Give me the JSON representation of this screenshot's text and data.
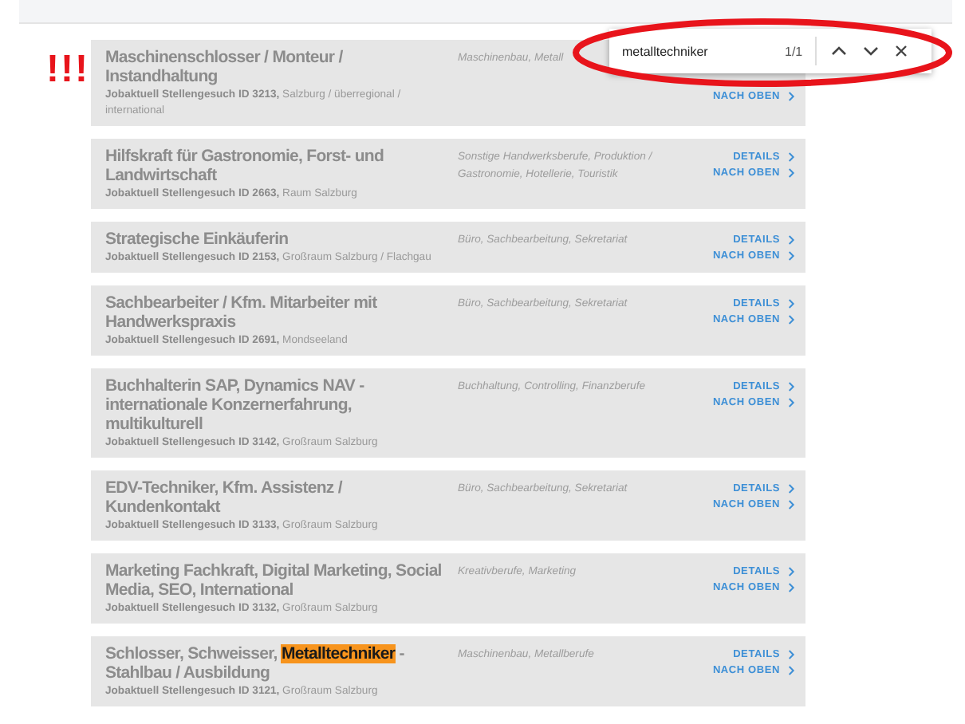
{
  "alert_mark": "!!!",
  "find_bar": {
    "value": "metalltechniker",
    "count": "1/1"
  },
  "jobs": [
    {
      "title_parts": [
        {
          "text": "Maschinenschlosser / Monteur / Instandhaltung",
          "highlighted": false
        }
      ],
      "source": "Jobaktuell Stellengesuch ID 3213,",
      "location": "Salzburg / überregional / international",
      "category": "Maschinenbau, Metall",
      "links": [
        "NACH OBEN"
      ]
    },
    {
      "title_parts": [
        {
          "text": "Hilfskraft für Gastronomie, Forst- und Landwirtschaft",
          "highlighted": false
        }
      ],
      "source": "Jobaktuell Stellengesuch ID 2663,",
      "location": "Raum Salzburg",
      "category": "Sonstige Handwerksberufe, Produktion / Gastronomie, Hotellerie, Touristik",
      "links": [
        "DETAILS",
        "NACH OBEN"
      ]
    },
    {
      "title_parts": [
        {
          "text": "Strategische Einkäuferin",
          "highlighted": false
        }
      ],
      "source": "Jobaktuell Stellengesuch ID 2153,",
      "location": "Großraum Salzburg / Flachgau",
      "category": "Büro, Sachbearbeitung, Sekretariat",
      "links": [
        "DETAILS",
        "NACH OBEN"
      ]
    },
    {
      "title_parts": [
        {
          "text": "Sachbearbeiter / Kfm. Mitarbeiter mit Handwerkspraxis",
          "highlighted": false
        }
      ],
      "source": "Jobaktuell Stellengesuch ID 2691,",
      "location": "Mondseeland",
      "category": "Büro, Sachbearbeitung, Sekretariat",
      "links": [
        "DETAILS",
        "NACH OBEN"
      ]
    },
    {
      "title_parts": [
        {
          "text": "Buchhalterin SAP, Dynamics NAV - internationale Konzernerfahrung, multikulturell",
          "highlighted": false
        }
      ],
      "source": "Jobaktuell Stellengesuch ID 3142,",
      "location": "Großraum Salzburg",
      "category": "Buchhaltung, Controlling, Finanzberufe",
      "links": [
        "DETAILS",
        "NACH OBEN"
      ]
    },
    {
      "title_parts": [
        {
          "text": "EDV-Techniker, Kfm. Assistenz / Kundenkontakt",
          "highlighted": false
        }
      ],
      "source": "Jobaktuell Stellengesuch ID 3133,",
      "location": "Großraum Salzburg",
      "category": "Büro, Sachbearbeitung, Sekretariat",
      "links": [
        "DETAILS",
        "NACH OBEN"
      ]
    },
    {
      "title_parts": [
        {
          "text": "Marketing Fachkraft, Digital Marketing, Social Media, SEO, International",
          "highlighted": false
        }
      ],
      "source": "Jobaktuell Stellengesuch ID 3132,",
      "location": "Großraum Salzburg",
      "category": "Kreativberufe, Marketing",
      "links": [
        "DETAILS",
        "NACH OBEN"
      ]
    },
    {
      "title_parts": [
        {
          "text": "Schlosser, Schweisser, ",
          "highlighted": false
        },
        {
          "text": "Metalltechniker",
          "highlighted": true
        },
        {
          "text": " - Stahlbau / Ausbildung",
          "highlighted": false
        }
      ],
      "source": "Jobaktuell Stellengesuch ID 3121,",
      "location": "Großraum Salzburg",
      "category": "Maschinenbau, Metallberufe",
      "links": [
        "DETAILS",
        "NACH OBEN"
      ]
    }
  ]
}
